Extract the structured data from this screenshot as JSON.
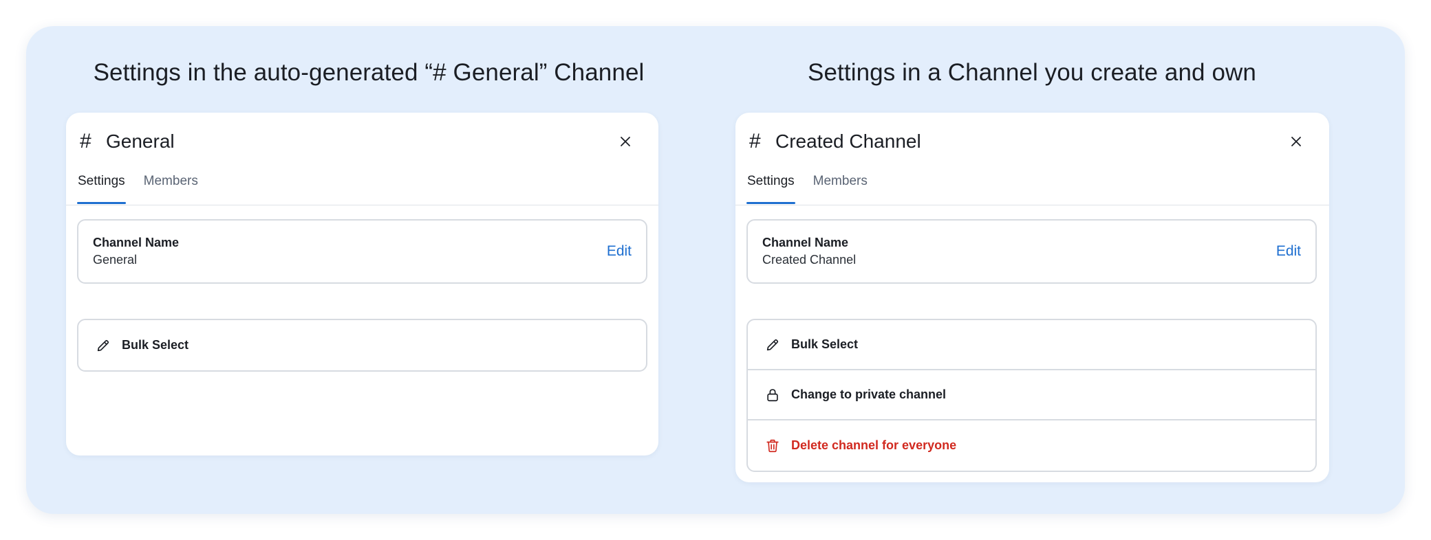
{
  "headings": {
    "left": "Settings in the auto-generated “# General” Channel",
    "right": "Settings in a Channel you create and own"
  },
  "left_panel": {
    "hash": "#",
    "title": "General",
    "tabs": [
      {
        "label": "Settings",
        "active": true
      },
      {
        "label": "Members",
        "active": false
      }
    ],
    "channel_name_label": "Channel Name",
    "channel_name_value": "General",
    "edit_label": "Edit",
    "actions": [
      {
        "label": "Bulk Select",
        "icon": "pencil-icon"
      }
    ]
  },
  "right_panel": {
    "hash": "#",
    "title": "Created Channel",
    "tabs": [
      {
        "label": "Settings",
        "active": true
      },
      {
        "label": "Members",
        "active": false
      }
    ],
    "channel_name_label": "Channel Name",
    "channel_name_value": "Created Channel",
    "edit_label": "Edit",
    "actions": [
      {
        "label": "Bulk Select",
        "icon": "pencil-icon"
      },
      {
        "label": "Change to private channel",
        "icon": "lock-icon"
      },
      {
        "label": "Delete channel for everyone",
        "icon": "trash-icon",
        "danger": true
      }
    ]
  },
  "colors": {
    "background": "#e3eefc",
    "accent": "#1e6fd0",
    "danger": "#d1291f",
    "border": "#d7dbe1"
  }
}
